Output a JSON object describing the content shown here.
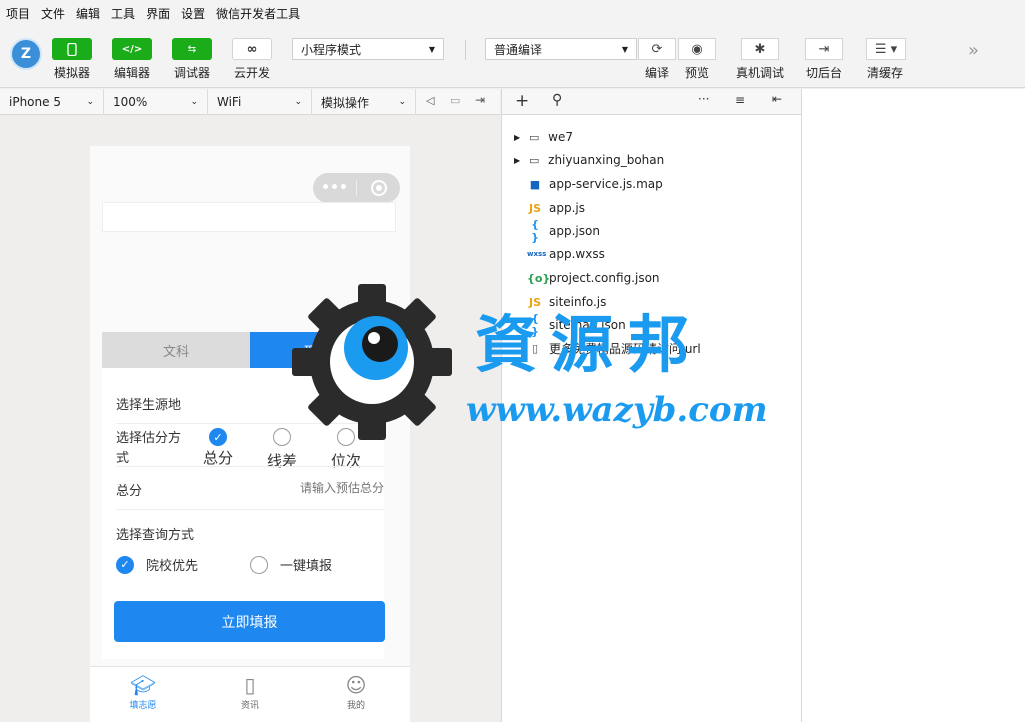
{
  "menu": [
    "项目",
    "文件",
    "编辑",
    "工具",
    "界面",
    "设置",
    "微信开发者工具"
  ],
  "toolbar": {
    "simulator_label": "模拟器",
    "editor_label": "编辑器",
    "debugger_label": "调试器",
    "cloud_label": "云开发",
    "mode_select": "小程序模式",
    "compile_select": "普通编译",
    "compile_label": "编译",
    "preview_label": "预览",
    "remote_debug_label": "真机调试",
    "background_label": "切后台",
    "clear_cache_label": "清缓存"
  },
  "device_bar": {
    "device": "iPhone 5",
    "zoom": "100%",
    "network": "WiFi",
    "operation": "模拟操作"
  },
  "phone": {
    "tabs": [
      "文科",
      "理科"
    ],
    "active_tab": 1,
    "source_label": "选择生源地",
    "source_value": "河北",
    "estimate_label": "选择估分方式",
    "estimate_options": [
      "总分",
      "线差",
      "位次"
    ],
    "estimate_selected": 0,
    "score_label": "总分",
    "score_placeholder": "请输入预估总分",
    "query_label": "选择查询方式",
    "query_options": [
      "院校优先",
      "一键填报"
    ],
    "query_selected": 0,
    "submit_label": "立即填报",
    "tabbar": [
      "填志愿",
      "资讯",
      "我的"
    ]
  },
  "files": [
    {
      "name": "we7",
      "type": "folder"
    },
    {
      "name": "zhiyuanxing_bohan",
      "type": "folder"
    },
    {
      "name": "app-service.js.map",
      "type": "map"
    },
    {
      "name": "app.js",
      "type": "js"
    },
    {
      "name": "app.json",
      "type": "json"
    },
    {
      "name": "app.wxss",
      "type": "wxss"
    },
    {
      "name": "project.config.json",
      "type": "config"
    },
    {
      "name": "siteinfo.js",
      "type": "js"
    },
    {
      "name": "sitemap.json",
      "type": "json"
    },
    {
      "name": "更多免费精品源码请访问.url",
      "type": "file"
    }
  ],
  "watermark": {
    "cn": "資源邦",
    "url": "www.wazyb.com"
  },
  "colors": {
    "accent": "#1e88f0",
    "wechat_green": "#1aad19"
  }
}
